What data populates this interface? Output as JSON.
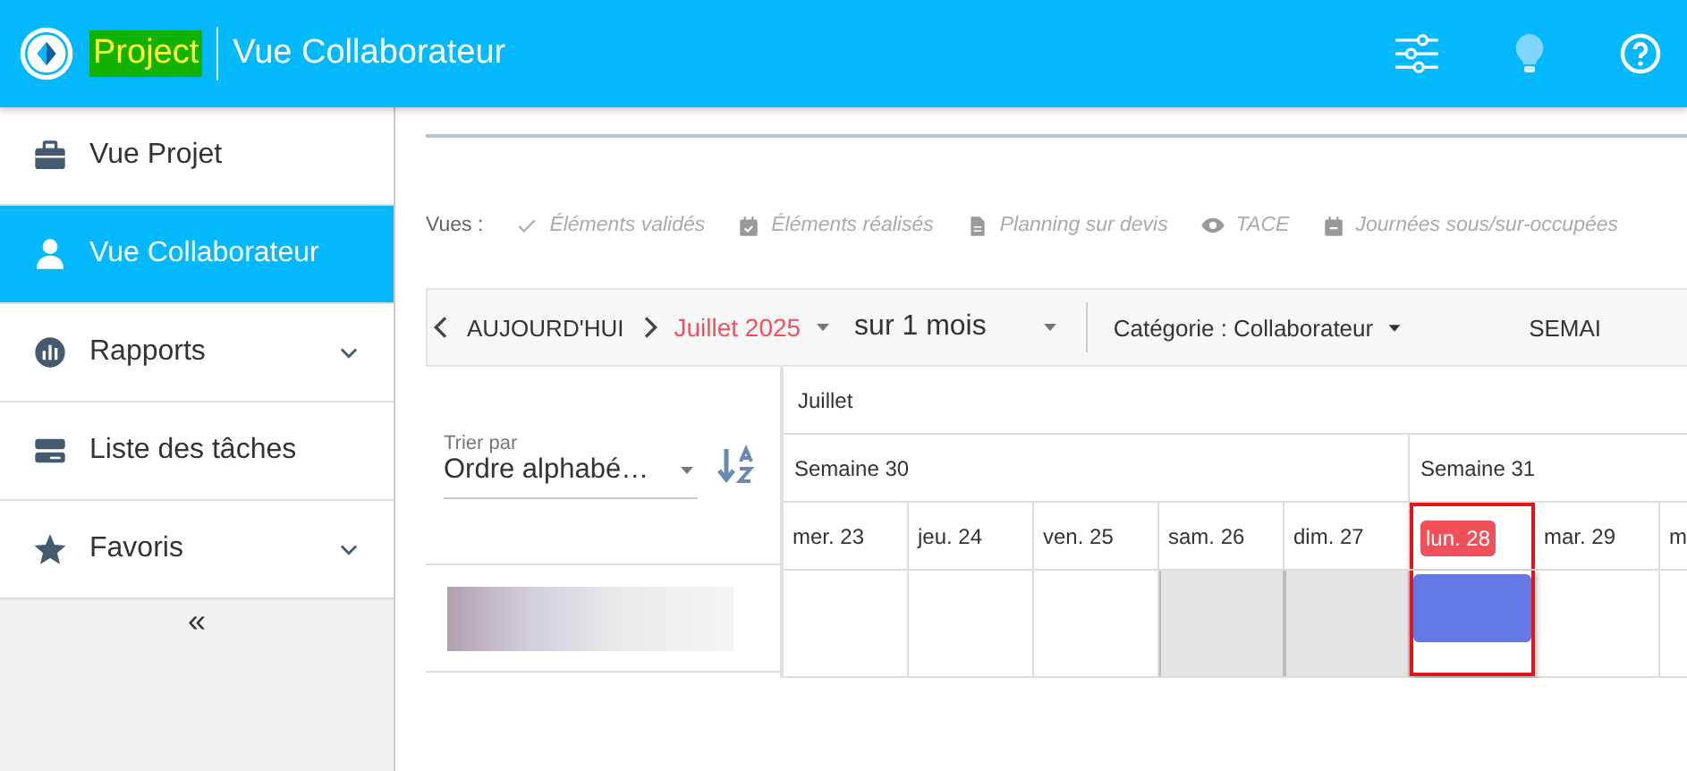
{
  "header": {
    "brand": "Project",
    "title": "Vue Collaborateur"
  },
  "sidebar": {
    "items": [
      {
        "label": "Vue Projet",
        "selected": false,
        "expandable": false
      },
      {
        "label": "Vue Collaborateur",
        "selected": true,
        "expandable": false
      },
      {
        "label": "Rapports",
        "selected": false,
        "expandable": true
      },
      {
        "label": "Liste des tâches",
        "selected": false,
        "expandable": false
      },
      {
        "label": "Favoris",
        "selected": false,
        "expandable": true
      }
    ],
    "collapse": "«"
  },
  "views": {
    "label": "Vues :",
    "items": [
      "Éléments validés",
      "Éléments réalisés",
      "Planning sur devis",
      "TACE",
      "Journées sous/sur-occupées"
    ]
  },
  "toolbar": {
    "today": "AUJOURD'HUI",
    "month": "Juillet 2025",
    "range": "sur 1 mois",
    "category": "Catégorie : Collaborateur",
    "cut_button": "SEMAI"
  },
  "sort": {
    "label": "Trier par",
    "value": "Ordre alphabé…"
  },
  "calendar": {
    "month": "Juillet",
    "weeks": [
      {
        "label": "Semaine 30",
        "days": [
          {
            "label": "mer. 23",
            "weekend": false,
            "today": false,
            "has_event": false
          },
          {
            "label": "jeu. 24",
            "weekend": false,
            "today": false,
            "has_event": false
          },
          {
            "label": "ven. 25",
            "weekend": false,
            "today": false,
            "has_event": false
          },
          {
            "label": "sam. 26",
            "weekend": true,
            "today": false,
            "has_event": false
          },
          {
            "label": "dim. 27",
            "weekend": true,
            "today": false,
            "has_event": false
          }
        ]
      },
      {
        "label": "Semaine 31",
        "days": [
          {
            "label": "lun. 28",
            "weekend": false,
            "today": true,
            "has_event": true
          },
          {
            "label": "mar. 29",
            "weekend": false,
            "today": false,
            "has_event": false
          },
          {
            "label": "m",
            "weekend": false,
            "today": false,
            "has_event": false
          }
        ]
      }
    ]
  }
}
